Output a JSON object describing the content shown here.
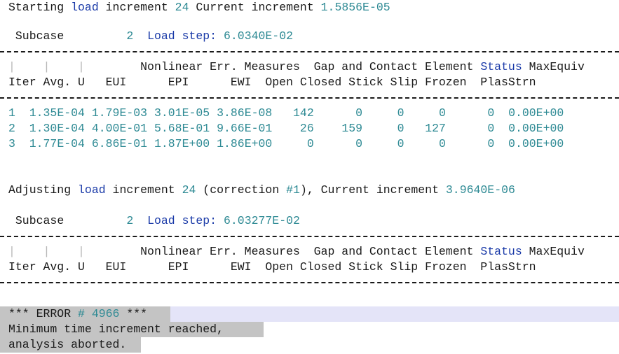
{
  "block1": {
    "w_starting": "Starting",
    "w_load": "load",
    "w_increment": "increment",
    "inc_num": "24",
    "w_current": "Current",
    "w_increment2": "increment",
    "inc_value": "1.5856E-05",
    "w_subcase": "Subcase",
    "subcase_num": "2",
    "w_loadstep": "Load step:",
    "loadstep_value": "6.0340E-02"
  },
  "header": {
    "dots": "|    |    |",
    "row1_a": "Nonlinear Err. Measures  Gap and Contact Element ",
    "status": "Status",
    "row1_b": " MaxEquiv",
    "row2": "Iter Avg. U   EUI      EPI      EWI  Open Closed Stick Slip Frozen  PlasStrn"
  },
  "iterations": [
    {
      "iter": "1",
      "avg_u": "1.35E-04",
      "eui": "1.79E-03",
      "epi": "3.01E-05",
      "ewi": "3.86E-08",
      "open": "142",
      "closed": "0",
      "stick": "0",
      "slip": "0",
      "frozen": "0",
      "plas": "0.00E+00"
    },
    {
      "iter": "2",
      "avg_u": "1.30E-04",
      "eui": "4.00E-01",
      "epi": "5.68E-01",
      "ewi": "9.66E-01",
      "open": "26",
      "closed": "159",
      "stick": "0",
      "slip": "127",
      "frozen": "0",
      "plas": "0.00E+00"
    },
    {
      "iter": "3",
      "avg_u": "1.77E-04",
      "eui": "6.86E-01",
      "epi": "1.87E+00",
      "ewi": "1.86E+00",
      "open": "0",
      "closed": "0",
      "stick": "0",
      "slip": "0",
      "frozen": "0",
      "plas": "0.00E+00"
    }
  ],
  "block2": {
    "w_adjusting": "Adjusting",
    "w_load": "load",
    "w_increment": "increment",
    "inc_num": "24",
    "w_correction_open": "(correction",
    "correction_num": "#1",
    "w_correction_close": "), Current increment",
    "inc_value": "3.9640E-06",
    "w_subcase": "Subcase",
    "subcase_num": "2",
    "w_loadstep": "Load step:",
    "loadstep_value": "6.03277E-02"
  },
  "error": {
    "stars_open": "*** ERROR ",
    "code": "# 4966",
    "stars_close": " ***",
    "line2": "Minimum time increment reached,",
    "line3": "analysis aborted."
  },
  "colors": {
    "keyword": "#1a3aa8",
    "number": "#2e8a94",
    "selection": "#c4c4c4",
    "error_band": "#e4e4f8"
  }
}
